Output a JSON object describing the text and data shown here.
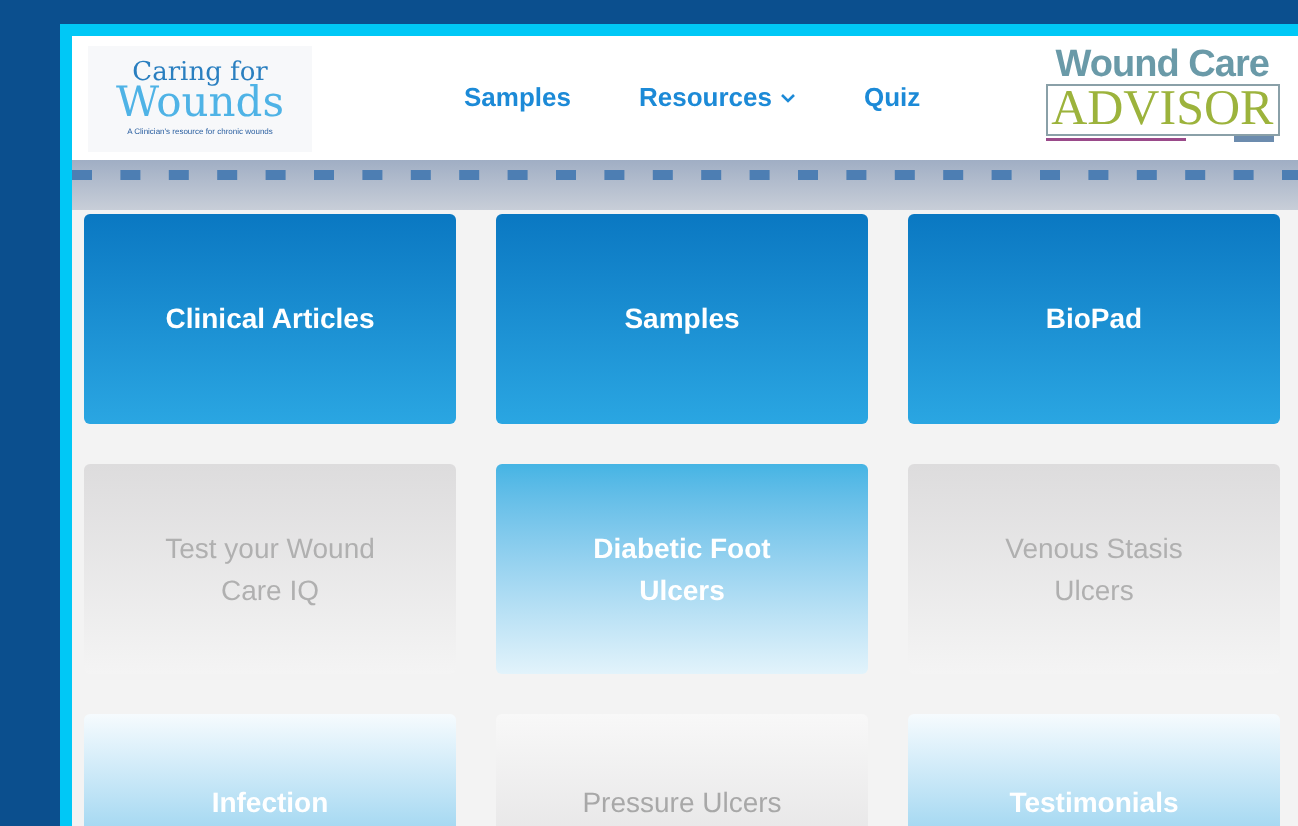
{
  "logo": {
    "line_1": "Caring for",
    "line_2": "Wounds",
    "tagline": "A Clinician's resource for chronic wounds"
  },
  "nav": [
    {
      "label": "Samples",
      "kind": "link"
    },
    {
      "label": "Resources",
      "kind": "dropdown"
    },
    {
      "label": "Quiz",
      "kind": "link"
    }
  ],
  "partner_logo": {
    "line_1": "Wound Care",
    "line_2": "ADVISOR"
  },
  "tiles": [
    {
      "label": "Clinical Articles",
      "kind": "deep"
    },
    {
      "label": "Samples",
      "kind": "deep"
    },
    {
      "label": "BioPad",
      "kind": "deep"
    },
    {
      "label": "Test your Wound Care IQ",
      "kind": "grey"
    },
    {
      "label": "Diabetic Foot Ulcers",
      "kind": "fade"
    },
    {
      "label": "Venous Stasis Ulcers",
      "kind": "grey"
    },
    {
      "label": "Infection",
      "kind": "rise"
    },
    {
      "label": "Pressure Ulcers",
      "kind": "grey-rise"
    },
    {
      "label": "Testimonials",
      "kind": "rise"
    }
  ]
}
